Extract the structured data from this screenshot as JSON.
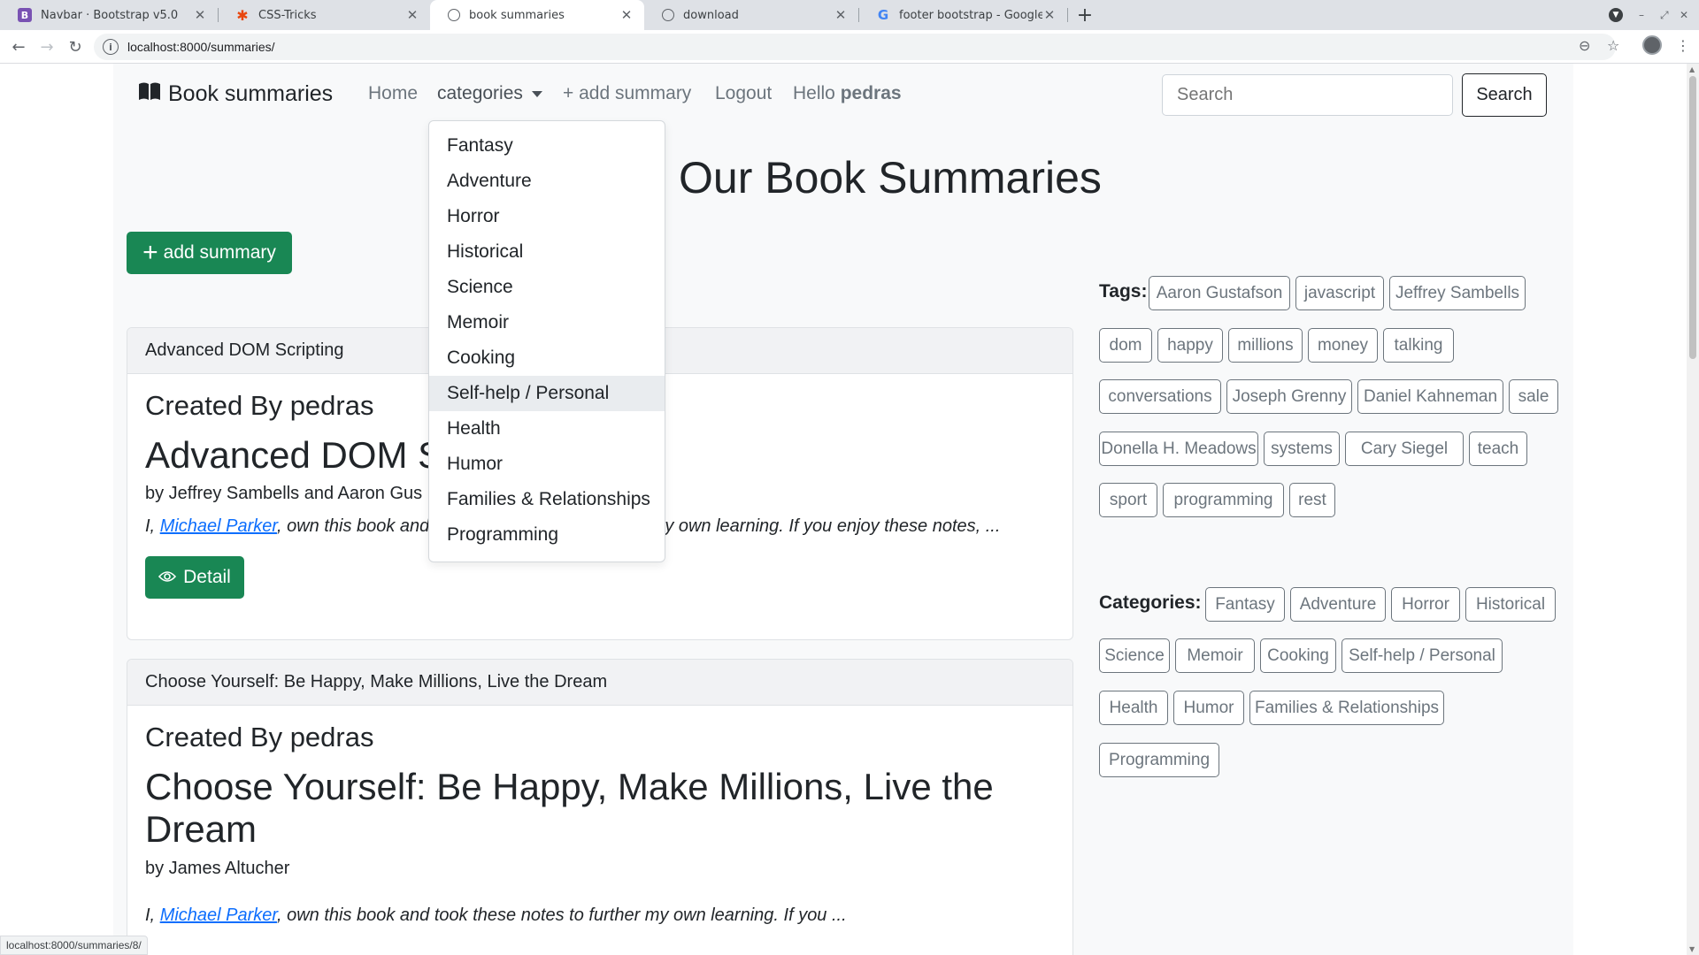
{
  "browser": {
    "tabs": [
      {
        "title": "Navbar · Bootstrap v5.0",
        "favicon": "bootstrap-icon",
        "color": "#7952b3",
        "active": false
      },
      {
        "title": "CSS-Tricks",
        "favicon": "css-tricks-icon",
        "color": "#e8470f",
        "active": false
      },
      {
        "title": "book summaries",
        "favicon": "globe-icon",
        "color": "#5f6368",
        "active": true
      },
      {
        "title": "download",
        "favicon": "globe-icon",
        "color": "#5f6368",
        "active": false
      },
      {
        "title": "footer bootstrap - Google Sear",
        "favicon": "google-icon",
        "color": "#4285f4",
        "active": false
      }
    ],
    "url": "localhost:8000/summaries/",
    "status_url": "localhost:8000/summaries/8/"
  },
  "navbar": {
    "brand": "Book summaries",
    "home": "Home",
    "categories": "categories",
    "add_summary": "+ add summary",
    "logout": "Logout",
    "hello_prefix": "Hello",
    "username": "pedras",
    "search_placeholder": "Search",
    "search_button": "Search"
  },
  "dropdown": {
    "items": [
      "Fantasy",
      "Adventure",
      "Horror",
      "Historical",
      "Science",
      "Memoir",
      "Cooking",
      "Self-help / Personal",
      "Health",
      "Humor",
      "Families & Relationships",
      "Programming"
    ],
    "hovered": "Self-help / Personal"
  },
  "main": {
    "title": "Our Book Summaries",
    "add_button": "add summary",
    "cards": [
      {
        "header": "Advanced DOM Scripting",
        "created_by": "Created By pedras",
        "title": "Advanced DOM S",
        "authors": "by Jeffrey Sambells and Aaron Gus",
        "excerpt_prefix": "I,",
        "excerpt_link": "Michael Parker",
        "excerpt_mid": ", own this book and",
        "excerpt_tail": "y own learning. If you enjoy these notes, ...",
        "detail": "Detail"
      },
      {
        "header": "Choose Yourself: Be Happy, Make Millions, Live the Dream",
        "created_by": "Created By pedras",
        "title": "Choose Yourself: Be Happy, Make Millions, Live the Dream",
        "authors": "by James Altucher",
        "excerpt_prefix": "I,",
        "excerpt_link": "Michael Parker",
        "excerpt_rest": ", own this book and took these notes to further my own learning. If you ..."
      }
    ]
  },
  "sidebar": {
    "tags_label": "Tags:",
    "tags": [
      "Aaron Gustafson",
      "javascript",
      "Jeffrey Sambells",
      "dom",
      "happy",
      "millions",
      "money",
      "talking",
      "conversations",
      "Joseph Grenny",
      "Daniel Kahneman",
      "sale",
      "Donella H. Meadows",
      "systems",
      "Cary Siegel",
      "teach",
      "sport",
      "programming",
      "rest"
    ],
    "categories_label": "Categories:",
    "categories": [
      "Fantasy",
      "Adventure",
      "Horror",
      "Historical",
      "Science",
      "Memoir",
      "Cooking",
      "Self-help / Personal",
      "Health",
      "Humor",
      "Families & Relationships",
      "Programming"
    ]
  },
  "colors": {
    "success": "#198754",
    "link": "#0d6efd",
    "muted": "#6c757d"
  }
}
